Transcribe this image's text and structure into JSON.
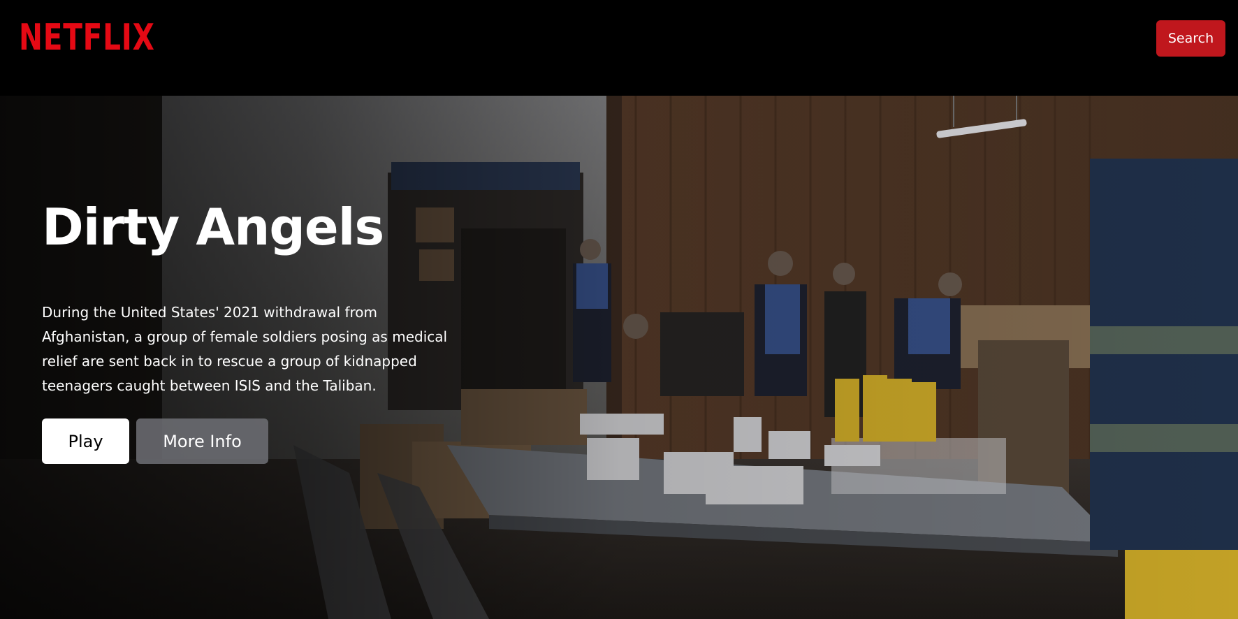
{
  "header": {
    "logo": "NETFLIX",
    "search_label": "Search"
  },
  "hero": {
    "title": "Dirty Angels",
    "synopsis": "During the United States' 2021 withdrawal from Afghanistan, a group of female soldiers posing as medical relief are sent back in to rescue a group of kidnapped teenagers caught between ISIS and the Taliban.",
    "play_label": "Play",
    "more_info_label": "More Info"
  },
  "colors": {
    "brand": "#e50914",
    "search_button": "#c0171d",
    "background": "#000000"
  }
}
